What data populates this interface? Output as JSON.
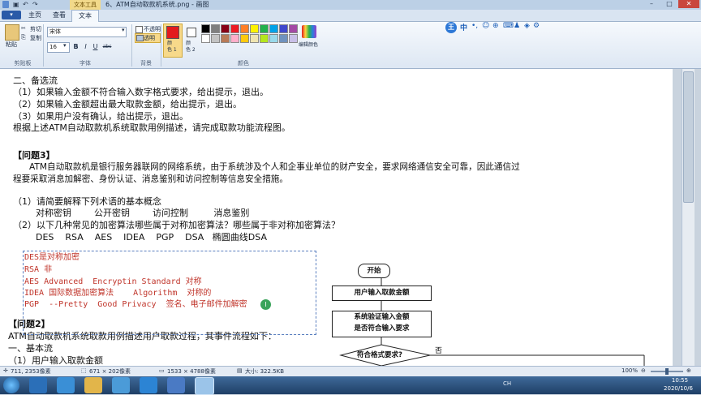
{
  "window": {
    "title": "6、ATM自动取款机系统.png - 画图",
    "context_tab": "文本工具",
    "controls": {
      "minimize": "–",
      "maximize": "□",
      "close": "✕"
    }
  },
  "tabs": [
    {
      "label": "主页"
    },
    {
      "label": "查看"
    },
    {
      "label": "文本"
    }
  ],
  "ribbon": {
    "clipboard": {
      "paste": "粘贴",
      "cut": "剪切",
      "copy": "复制",
      "group": "剪贴板"
    },
    "font": {
      "family": "宋体",
      "size": "16",
      "bold": "B",
      "italic": "I",
      "underline": "U",
      "strike": "abc",
      "group": "字体"
    },
    "background": {
      "opaque": "不透明",
      "transparent": "透明",
      "group": "背景"
    },
    "colors": {
      "color1_label": "颜\n色 1",
      "color1": "#e31a1c",
      "color2_label": "颜\n色 2",
      "color2": "#ffffff",
      "edit_label": "编辑颜色",
      "group": "颜色",
      "palette": [
        "#000000",
        "#7f7f7f",
        "#880015",
        "#ed1c24",
        "#ff7f27",
        "#fff200",
        "#22b14c",
        "#00a2e8",
        "#3f48cc",
        "#a349a4",
        "#ffffff",
        "#c3c3c3",
        "#b97a57",
        "#ffaec9",
        "#ffc90e",
        "#efe4b0",
        "#b5e61d",
        "#99d9ea",
        "#7092be",
        "#c8bfe7"
      ]
    }
  },
  "document": {
    "lines": [
      "二、备选流",
      "（1）如果输入金额不符合输入数字格式要求，给出提示，退出。",
      "（2）如果输入金额超出最大取款金额，给出提示，退出。",
      "（3）如果用户没有确认，给出提示，退出。",
      "根据上述ATM自动取款机系统取款用例描述，请完成取款功能流程图。",
      "【问题3】",
      "ATM自动取款机是银行服务器联网的网络系统，由于系统涉及个人和企事业单位的财产安全，要求网络通信安全可靠，因此通信过",
      "程要采取消息加解密、身份认证、消息鉴别和访问控制等信息安全措施。",
      "（1）请简要解释下列术语的基本概念",
      "对称密钥        公开密钥        访问控制         消息鉴别",
      "（2）以下几种常见的加密算法哪些属于对称加密算法？哪些属于非对称加密算法？",
      "DES    RSA    AES    IDEA    PGP    DSA   椭圆曲线DSA",
      "【问题2】",
      "ATM自动取款机系统取款用例描述用户取款过程，其事件流程如下：",
      "一、基本流",
      "（1）用户输入取款金额"
    ],
    "annotation": [
      "DES是对称加密",
      "RSA 非",
      "AES Advanced  Encryptin Standard 对称",
      "IDEA 国际数据加密算法    Algorithm  对称的",
      "PGP  --Pretty  Good Privacy  签名、电子邮件加解密"
    ],
    "flowchart": {
      "start": "开始",
      "step1": "用户输入取款金额",
      "step2_l1": "系统验证输入金额",
      "step2_l2": "是否符合输入要求",
      "decision": "符合格式要求?",
      "no_label": "否"
    }
  },
  "statusbar": {
    "cursor": "711, 2353像素",
    "selection": "671 × 202像素",
    "image_size": "1533 × 4788像素",
    "file_size": "大小: 322.5KB",
    "zoom": "100%"
  },
  "taskbar": {
    "time": "10:55",
    "date": "2020/10/6",
    "lang": "CH"
  }
}
